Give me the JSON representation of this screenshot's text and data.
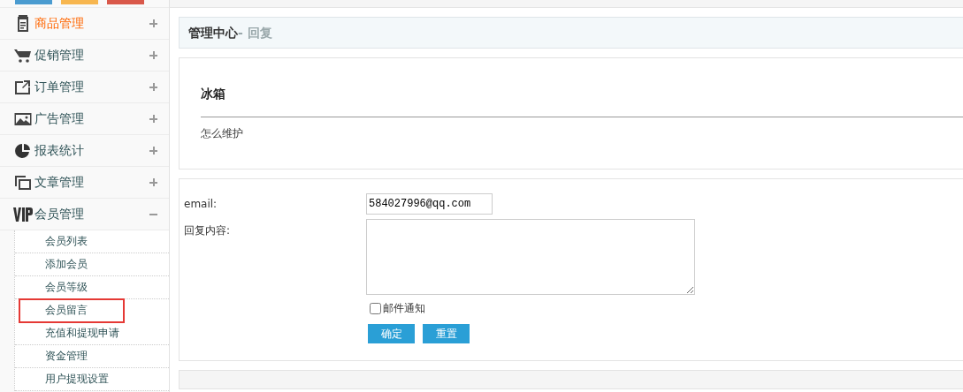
{
  "quick_buttons": [
    {
      "color": "#4a9bd0"
    },
    {
      "color": "#f7b64f"
    },
    {
      "color": "#d9584a"
    }
  ],
  "sidebar": {
    "items": [
      {
        "label": "商品管理",
        "selected": true,
        "expanded": false
      },
      {
        "label": "促销管理",
        "selected": false,
        "expanded": false
      },
      {
        "label": "订单管理",
        "selected": false,
        "expanded": false
      },
      {
        "label": "广告管理",
        "selected": false,
        "expanded": false
      },
      {
        "label": "报表统计",
        "selected": false,
        "expanded": false
      },
      {
        "label": "文章管理",
        "selected": false,
        "expanded": false
      },
      {
        "label": "会员管理",
        "selected": false,
        "expanded": true,
        "children": [
          {
            "label": "会员列表",
            "highlighted": false
          },
          {
            "label": "添加会员",
            "highlighted": false
          },
          {
            "label": "会员等级",
            "highlighted": false
          },
          {
            "label": "会员留言",
            "highlighted": true
          },
          {
            "label": "充值和提现申请",
            "highlighted": false
          },
          {
            "label": "资金管理",
            "highlighted": false
          },
          {
            "label": "用户提现设置",
            "highlighted": false
          }
        ]
      }
    ]
  },
  "breadcrumb": {
    "title": "管理中心",
    "current": "- 回复"
  },
  "message": {
    "subject": "冰箱",
    "body": "怎么维护"
  },
  "form": {
    "email_label": "email:",
    "email": "584027996@qq.com",
    "content_label": "回复内容:",
    "notify": {
      "label": "邮件通知",
      "checked": false
    },
    "buttons": [
      "确定",
      "重置"
    ]
  }
}
